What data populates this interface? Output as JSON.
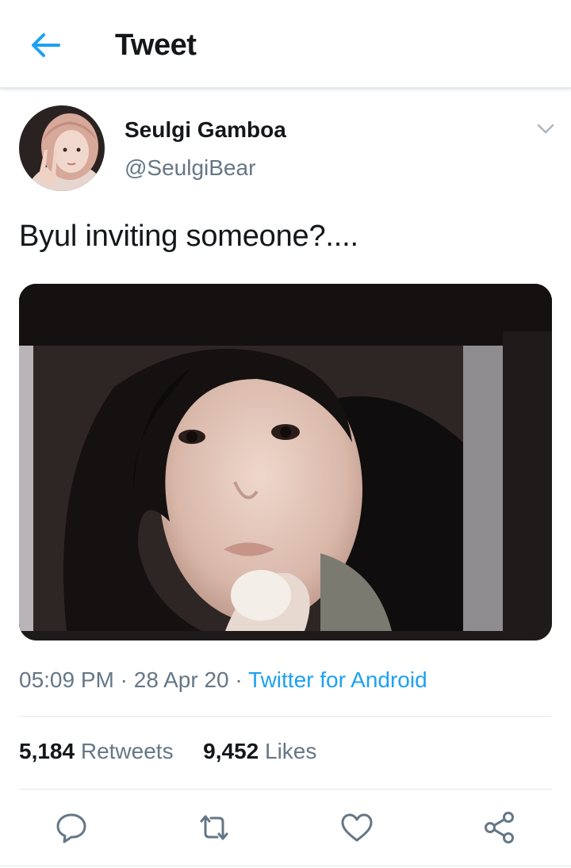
{
  "header": {
    "title": "Tweet"
  },
  "tweet": {
    "author": {
      "name": "Seulgi Gamboa",
      "handle": "@SeulgiBear"
    },
    "text": "Byul inviting someone?....",
    "time": "05:09 PM",
    "date": "28 Apr 20",
    "source": "Twitter for Android",
    "retweets": {
      "count": "5,184",
      "label": "Retweets"
    },
    "likes": {
      "count": "9,452",
      "label": "Likes"
    }
  },
  "icons": {
    "back": "arrow-left-icon",
    "more": "chevron-down-icon",
    "reply": "reply-bubble-icon",
    "retweet": "retweet-icon",
    "like": "heart-icon",
    "share": "share-icon"
  },
  "colors": {
    "accent": "#1da1f2",
    "secondary_text": "#657786",
    "primary_text": "#14171a",
    "divider": "#e1e8ed"
  }
}
